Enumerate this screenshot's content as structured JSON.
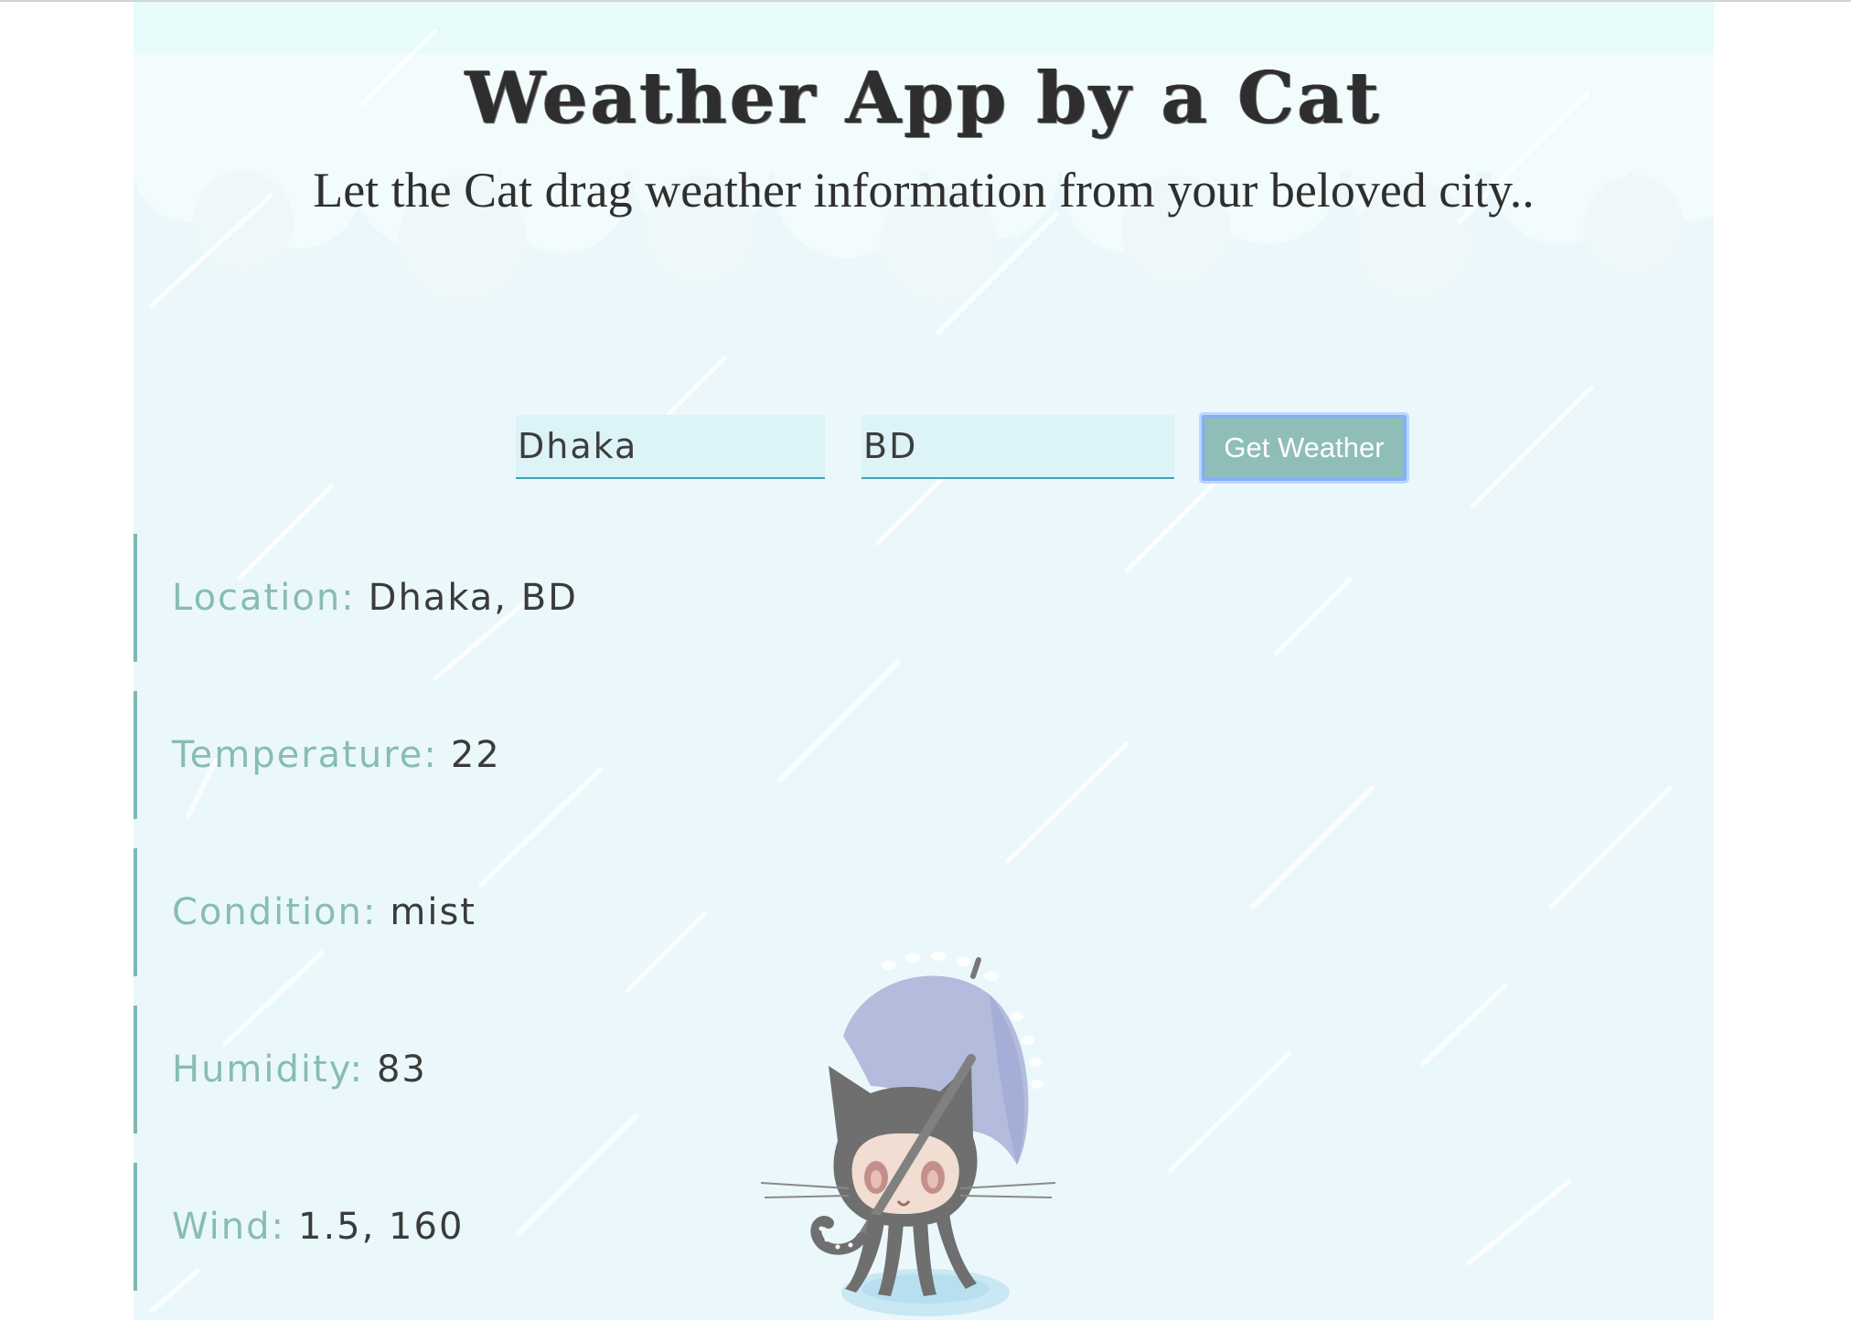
{
  "header": {
    "title": "Weather App by a Cat",
    "subtitle": "Let the Cat drag weather information from your beloved city.."
  },
  "form": {
    "city_value": "Dhaka",
    "country_value": "BD",
    "submit_label": "Get Weather"
  },
  "weather": {
    "location": {
      "label": "Location:",
      "value": "Dhaka, BD"
    },
    "temperature": {
      "label": "Temperature:",
      "value": "22"
    },
    "condition": {
      "label": "Condition:",
      "value": "mist"
    },
    "humidity": {
      "label": "Humidity:",
      "value": "83"
    },
    "wind": {
      "label": "Wind:",
      "value": "1.5, 160"
    }
  },
  "illustration": {
    "icon": "octocat-with-umbrella-icon"
  },
  "colors": {
    "background": "#ebf8fb",
    "accent": "#88bcb6",
    "button": "#8fbeb8",
    "input_underline": "#3aa6b6"
  }
}
